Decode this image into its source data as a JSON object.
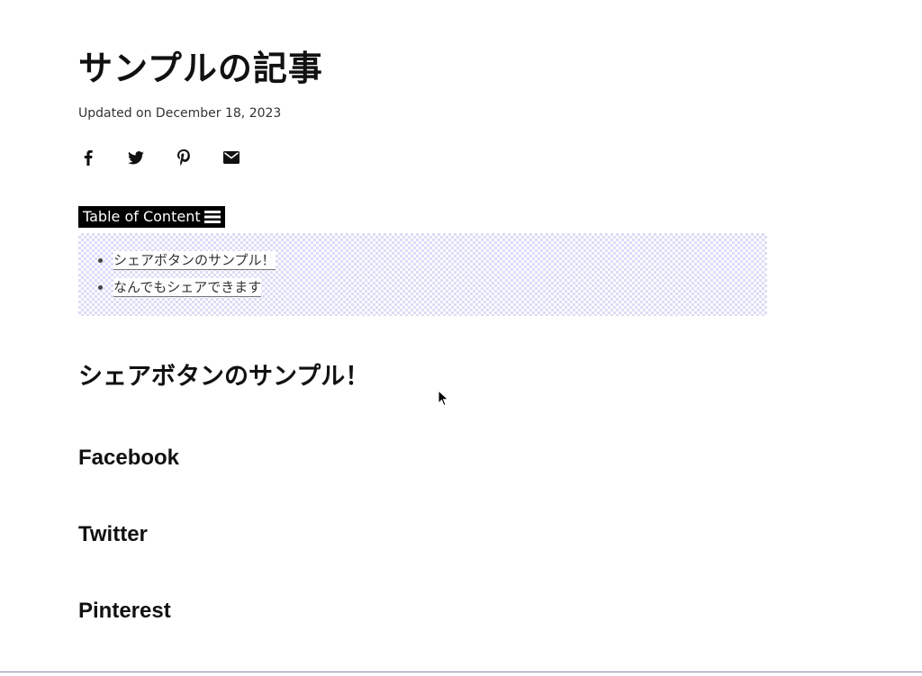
{
  "article": {
    "title": "サンプルの記事",
    "updated": "Updated on December 18, 2023"
  },
  "share": {
    "icons": [
      "facebook-icon",
      "twitter-icon",
      "pinterest-icon",
      "email-icon"
    ]
  },
  "toc": {
    "toggle_label": "Table of Content",
    "items": [
      {
        "label": "シェアボタンのサンプル！"
      },
      {
        "label": "なんでもシェアできます"
      }
    ]
  },
  "sections": {
    "heading": "シェアボタンのサンプル！",
    "facebook": "Facebook",
    "twitter": "Twitter",
    "pinterest": "Pinterest"
  },
  "colors": {
    "toc_pattern": "#dcdcf7",
    "toggle_bg": "#000000",
    "text": "#111111"
  }
}
